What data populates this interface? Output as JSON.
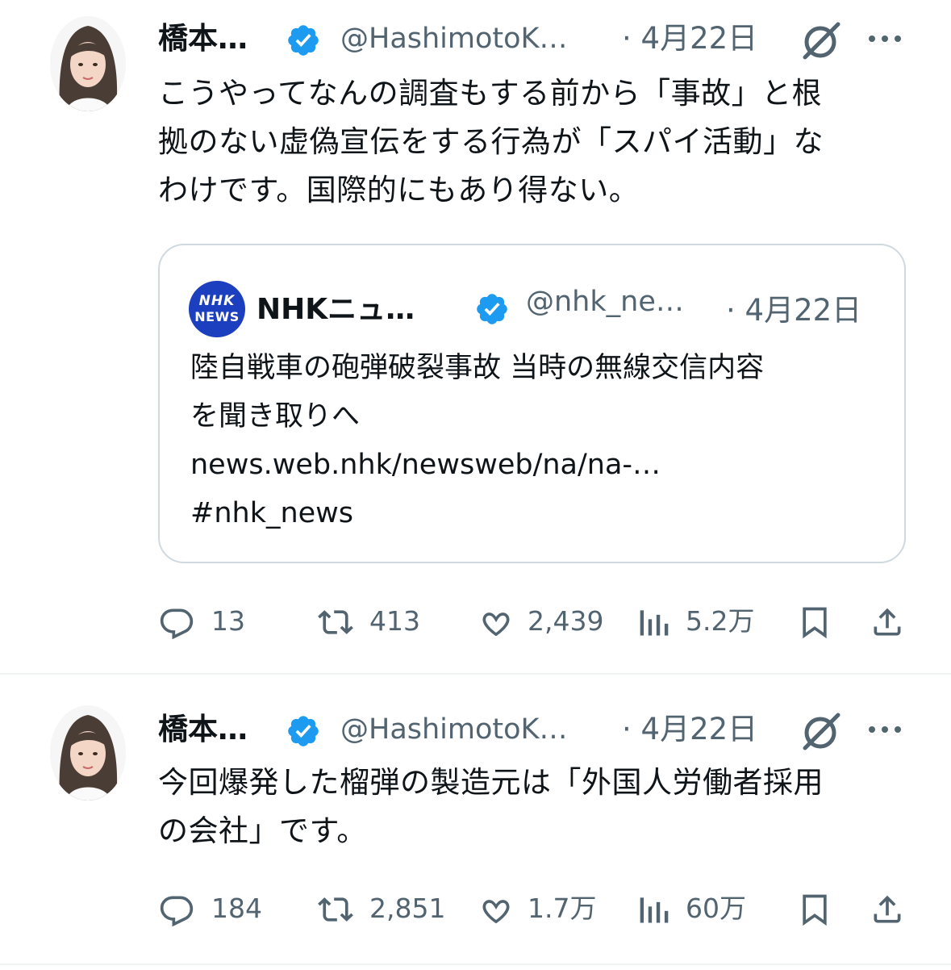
{
  "colors": {
    "verified_badge": "#1d9bf0",
    "secondary_text": "#536471",
    "primary_text": "#0f1419",
    "nhk_logo": "#1c3fbf",
    "border": "#cfd9de"
  },
  "tweets": [
    {
      "author_name": "橋本…",
      "handle": "@HashimotoK…",
      "date": "· 4月22日",
      "icons": [
        "avatar",
        "verified-badge-icon",
        "grok-icon",
        "more-icon"
      ],
      "text_lines": [
        "こうやってなんの調査もする前から「事故」と根",
        "拠のない虚偽宣伝をする行為が「スパイ活動」な",
        "わけです。国際的にもあり得ない。"
      ],
      "quote": {
        "logo_line1": "NHK",
        "logo_line2": "NEWS",
        "author_name": "NHKニュ…",
        "handle": "@nhk_ne…",
        "date": "· 4月22日",
        "text_lines": [
          "陸自戦車の砲弾破裂事故 当時の無線交信内容",
          "を聞き取りへ",
          "news.web.nhk/newsweb/na/na-…",
          "#nhk_news"
        ]
      },
      "stats": {
        "replies": "13",
        "retweets": "413",
        "likes": "2,439",
        "views": "5.2万"
      }
    },
    {
      "author_name": "橋本…",
      "handle": "@HashimotoK…",
      "date": "· 4月22日",
      "icons": [
        "avatar",
        "verified-badge-icon",
        "grok-icon",
        "more-icon"
      ],
      "text_lines": [
        "今回爆発した榴弾の製造元は「外国人労働者採用",
        "の会社」です。"
      ],
      "stats": {
        "replies": "184",
        "retweets": "2,851",
        "likes": "1.7万",
        "views": "60万"
      }
    }
  ]
}
